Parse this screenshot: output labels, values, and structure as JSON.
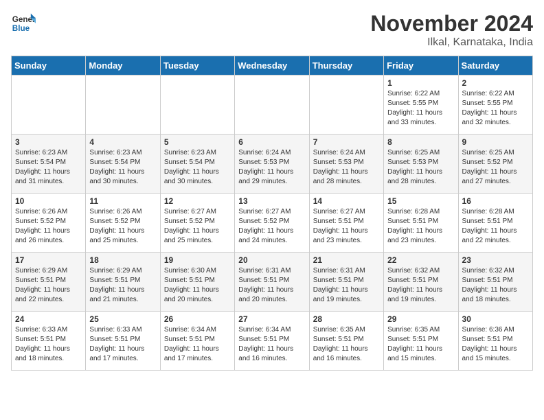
{
  "header": {
    "logo_line1": "General",
    "logo_line2": "Blue",
    "month": "November 2024",
    "location": "Ilkal, Karnataka, India"
  },
  "weekdays": [
    "Sunday",
    "Monday",
    "Tuesday",
    "Wednesday",
    "Thursday",
    "Friday",
    "Saturday"
  ],
  "weeks": [
    [
      {
        "day": "",
        "info": ""
      },
      {
        "day": "",
        "info": ""
      },
      {
        "day": "",
        "info": ""
      },
      {
        "day": "",
        "info": ""
      },
      {
        "day": "",
        "info": ""
      },
      {
        "day": "1",
        "info": "Sunrise: 6:22 AM\nSunset: 5:55 PM\nDaylight: 11 hours\nand 33 minutes."
      },
      {
        "day": "2",
        "info": "Sunrise: 6:22 AM\nSunset: 5:55 PM\nDaylight: 11 hours\nand 32 minutes."
      }
    ],
    [
      {
        "day": "3",
        "info": "Sunrise: 6:23 AM\nSunset: 5:54 PM\nDaylight: 11 hours\nand 31 minutes."
      },
      {
        "day": "4",
        "info": "Sunrise: 6:23 AM\nSunset: 5:54 PM\nDaylight: 11 hours\nand 30 minutes."
      },
      {
        "day": "5",
        "info": "Sunrise: 6:23 AM\nSunset: 5:54 PM\nDaylight: 11 hours\nand 30 minutes."
      },
      {
        "day": "6",
        "info": "Sunrise: 6:24 AM\nSunset: 5:53 PM\nDaylight: 11 hours\nand 29 minutes."
      },
      {
        "day": "7",
        "info": "Sunrise: 6:24 AM\nSunset: 5:53 PM\nDaylight: 11 hours\nand 28 minutes."
      },
      {
        "day": "8",
        "info": "Sunrise: 6:25 AM\nSunset: 5:53 PM\nDaylight: 11 hours\nand 28 minutes."
      },
      {
        "day": "9",
        "info": "Sunrise: 6:25 AM\nSunset: 5:52 PM\nDaylight: 11 hours\nand 27 minutes."
      }
    ],
    [
      {
        "day": "10",
        "info": "Sunrise: 6:26 AM\nSunset: 5:52 PM\nDaylight: 11 hours\nand 26 minutes."
      },
      {
        "day": "11",
        "info": "Sunrise: 6:26 AM\nSunset: 5:52 PM\nDaylight: 11 hours\nand 25 minutes."
      },
      {
        "day": "12",
        "info": "Sunrise: 6:27 AM\nSunset: 5:52 PM\nDaylight: 11 hours\nand 25 minutes."
      },
      {
        "day": "13",
        "info": "Sunrise: 6:27 AM\nSunset: 5:52 PM\nDaylight: 11 hours\nand 24 minutes."
      },
      {
        "day": "14",
        "info": "Sunrise: 6:27 AM\nSunset: 5:51 PM\nDaylight: 11 hours\nand 23 minutes."
      },
      {
        "day": "15",
        "info": "Sunrise: 6:28 AM\nSunset: 5:51 PM\nDaylight: 11 hours\nand 23 minutes."
      },
      {
        "day": "16",
        "info": "Sunrise: 6:28 AM\nSunset: 5:51 PM\nDaylight: 11 hours\nand 22 minutes."
      }
    ],
    [
      {
        "day": "17",
        "info": "Sunrise: 6:29 AM\nSunset: 5:51 PM\nDaylight: 11 hours\nand 22 minutes."
      },
      {
        "day": "18",
        "info": "Sunrise: 6:29 AM\nSunset: 5:51 PM\nDaylight: 11 hours\nand 21 minutes."
      },
      {
        "day": "19",
        "info": "Sunrise: 6:30 AM\nSunset: 5:51 PM\nDaylight: 11 hours\nand 20 minutes."
      },
      {
        "day": "20",
        "info": "Sunrise: 6:31 AM\nSunset: 5:51 PM\nDaylight: 11 hours\nand 20 minutes."
      },
      {
        "day": "21",
        "info": "Sunrise: 6:31 AM\nSunset: 5:51 PM\nDaylight: 11 hours\nand 19 minutes."
      },
      {
        "day": "22",
        "info": "Sunrise: 6:32 AM\nSunset: 5:51 PM\nDaylight: 11 hours\nand 19 minutes."
      },
      {
        "day": "23",
        "info": "Sunrise: 6:32 AM\nSunset: 5:51 PM\nDaylight: 11 hours\nand 18 minutes."
      }
    ],
    [
      {
        "day": "24",
        "info": "Sunrise: 6:33 AM\nSunset: 5:51 PM\nDaylight: 11 hours\nand 18 minutes."
      },
      {
        "day": "25",
        "info": "Sunrise: 6:33 AM\nSunset: 5:51 PM\nDaylight: 11 hours\nand 17 minutes."
      },
      {
        "day": "26",
        "info": "Sunrise: 6:34 AM\nSunset: 5:51 PM\nDaylight: 11 hours\nand 17 minutes."
      },
      {
        "day": "27",
        "info": "Sunrise: 6:34 AM\nSunset: 5:51 PM\nDaylight: 11 hours\nand 16 minutes."
      },
      {
        "day": "28",
        "info": "Sunrise: 6:35 AM\nSunset: 5:51 PM\nDaylight: 11 hours\nand 16 minutes."
      },
      {
        "day": "29",
        "info": "Sunrise: 6:35 AM\nSunset: 5:51 PM\nDaylight: 11 hours\nand 15 minutes."
      },
      {
        "day": "30",
        "info": "Sunrise: 6:36 AM\nSunset: 5:51 PM\nDaylight: 11 hours\nand 15 minutes."
      }
    ]
  ]
}
